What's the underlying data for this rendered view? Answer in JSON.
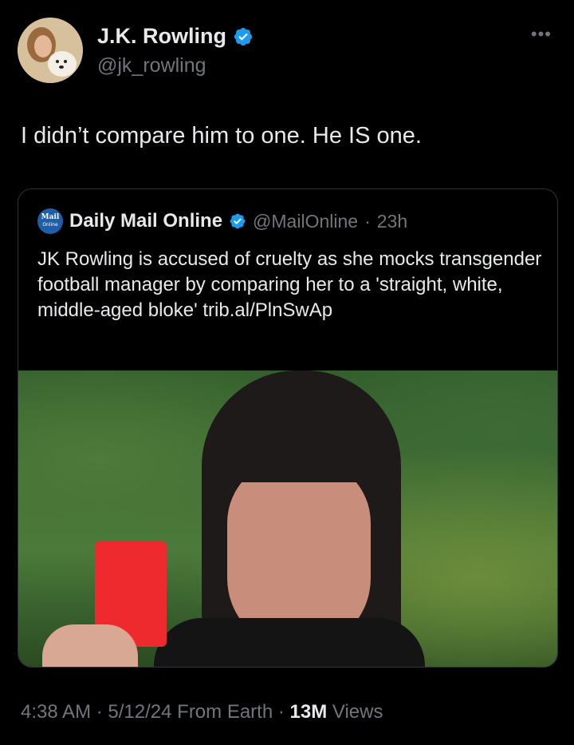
{
  "author": {
    "name": "J.K. Rowling",
    "handle": "@jk_rowling",
    "verified": true,
    "more_icon": "more-horizontal-icon"
  },
  "tweet": {
    "text": "I didn’t compare him to one. He IS one."
  },
  "quote": {
    "logo_text": "Mail",
    "logo_sub": "Online",
    "name": "Daily Mail Online",
    "handle": "@MailOnline",
    "separator": "·",
    "time": "23h",
    "text": "JK Rowling is accused of cruelty as she mocks transgender football manager by comparing her to a 'straight, white, middle-aged bloke' trib.al/PlnSwAp"
  },
  "footer": {
    "time": "4:38 AM",
    "date": "5/12/24",
    "source": "From Earth",
    "views_count": "13M",
    "views_label": "Views",
    "separator": "·"
  },
  "colors": {
    "background": "#000000",
    "text": "#e7e9ea",
    "muted": "#71767b",
    "verified_blue": "#1d9bf0",
    "border": "#2f3336"
  }
}
